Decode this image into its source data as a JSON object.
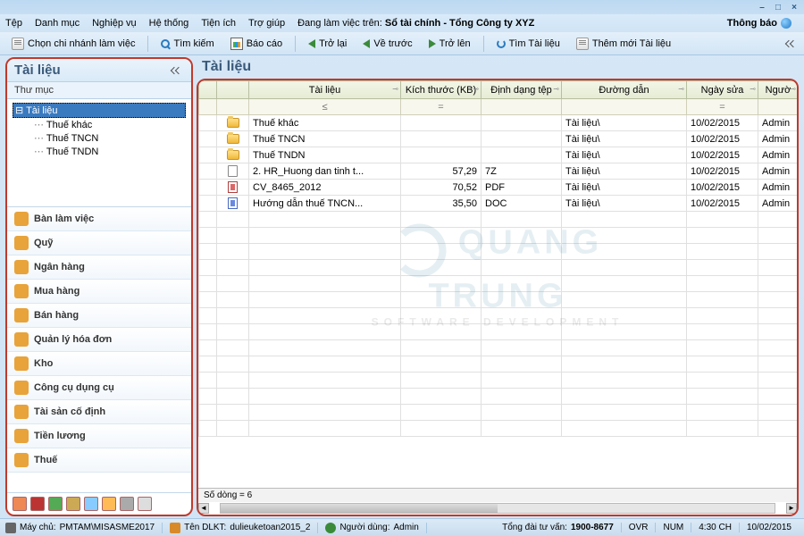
{
  "menu": {
    "items": [
      "Tệp",
      "Danh mục",
      "Nghiệp vụ",
      "Hệ thống",
      "Tiện ích",
      "Trợ giúp"
    ],
    "working_prefix": "Đang làm việc trên:",
    "working_value": "Sổ tài chính - Tổng Công ty XYZ",
    "thongbao": "Thông báo"
  },
  "toolbar": {
    "chon_chi_nhanh": "Chọn chi nhánh làm việc",
    "tim_kiem": "Tìm kiếm",
    "bao_cao": "Báo cáo",
    "tro_lai": "Trở lại",
    "ve_truoc": "Về trước",
    "tro_len": "Trở lên",
    "tim_tai_lieu": "Tìm Tài liệu",
    "them_moi": "Thêm mới Tài liệu"
  },
  "sidebar": {
    "title": "Tài liệu",
    "tree_header": "Thư mục",
    "tree_root": "Tài liệu",
    "tree_children": [
      "Thuế khác",
      "Thuế TNCN",
      "Thuế TNDN"
    ],
    "nav": [
      "Bàn làm việc",
      "Quỹ",
      "Ngân hàng",
      "Mua hàng",
      "Bán hàng",
      "Quản lý hóa đơn",
      "Kho",
      "Công cụ dụng cụ",
      "Tài sản cố định",
      "Tiền lương",
      "Thuế"
    ]
  },
  "main": {
    "title": "Tài liệu",
    "columns": [
      "",
      "",
      "Tài liệu",
      "Kích thước (KB)",
      "Định dạng tệp",
      "Đường dẫn",
      "Ngày sửa",
      "Ngườ"
    ],
    "filter_ops": [
      "",
      "",
      "≤",
      "=",
      "",
      "",
      "=",
      ""
    ],
    "rows": [
      {
        "icon": "folder",
        "name": "Thuế khác",
        "size": "",
        "ext": "",
        "path": "Tài liệu\\",
        "date": "10/02/2015",
        "user": "Admin"
      },
      {
        "icon": "folder",
        "name": "Thuế TNCN",
        "size": "",
        "ext": "",
        "path": "Tài liệu\\",
        "date": "10/02/2015",
        "user": "Admin"
      },
      {
        "icon": "folder",
        "name": "Thuế TNDN",
        "size": "",
        "ext": "",
        "path": "Tài liệu\\",
        "date": "10/02/2015",
        "user": "Admin"
      },
      {
        "icon": "file",
        "name": "2. HR_Huong dan tinh t...",
        "size": "57,29",
        "ext": "7Z",
        "path": "Tài liệu\\",
        "date": "10/02/2015",
        "user": "Admin"
      },
      {
        "icon": "pdf",
        "name": "CV_8465_2012",
        "size": "70,52",
        "ext": "PDF",
        "path": "Tài liệu\\",
        "date": "10/02/2015",
        "user": "Admin"
      },
      {
        "icon": "doc",
        "name": "Hướng dẫn thuế TNCN...",
        "size": "35,50",
        "ext": "DOC",
        "path": "Tài liệu\\",
        "date": "10/02/2015",
        "user": "Admin"
      }
    ],
    "row_count_label": "Số dòng = 6"
  },
  "watermark": {
    "line1": "QUANG TRUNG",
    "line2": "SOFTWARE DEVELOPMENT"
  },
  "status": {
    "server_label": "Máy chủ:",
    "server_value": "PMTAM\\MISASME2017",
    "db_label": "Tên DLKT:",
    "db_value": "dulieuketoan2015_2",
    "user_label": "Người dùng:",
    "user_value": "Admin",
    "hotline_label": "Tổng đài tư vấn:",
    "hotline_value": "1900-8677",
    "ovr": "OVR",
    "num": "NUM",
    "time": "4:30 CH",
    "date": "10/02/2015"
  }
}
